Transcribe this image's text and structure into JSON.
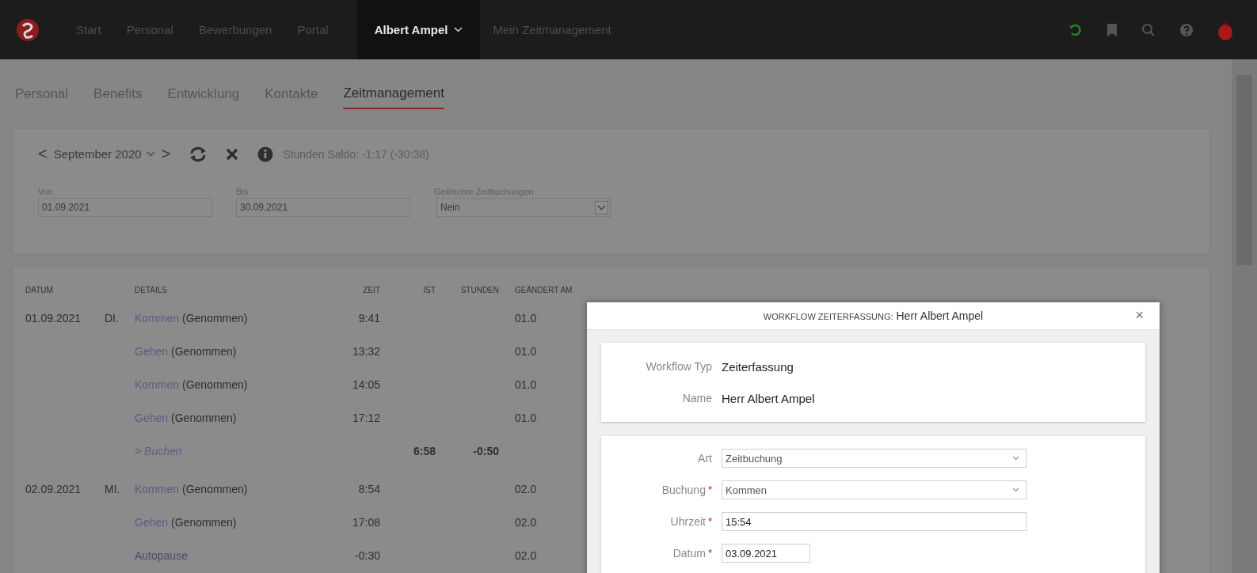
{
  "topbar": {
    "items": [
      {
        "label": "Start",
        "selected": false
      },
      {
        "label": "Personal",
        "selected": false
      },
      {
        "label": "Bewerbungen",
        "selected": false
      },
      {
        "label": "Portal",
        "selected": false
      },
      {
        "label": "Albert Ampel",
        "selected": true,
        "dropdown": true
      },
      {
        "label": "Mein Zeitmanagement",
        "selected": false
      }
    ]
  },
  "tabs": [
    {
      "label": "Personal",
      "selected": false
    },
    {
      "label": "Benefits",
      "selected": false
    },
    {
      "label": "Entwicklung",
      "selected": false
    },
    {
      "label": "Kontakte",
      "selected": false
    },
    {
      "label": "Zeitmanagement",
      "selected": true
    }
  ],
  "toolbar": {
    "prev": "<",
    "month": "September 2020",
    "next": ">",
    "saldo": "Stunden Saldo: -1:17 (-30:38)"
  },
  "filters": [
    {
      "label": "Von",
      "value": "01.09.2021",
      "kind": "input"
    },
    {
      "label": "Bis",
      "value": "30.09.2021",
      "kind": "input"
    },
    {
      "label": "Gelöschte Zeitbuchungen",
      "value": "Nein",
      "kind": "select"
    }
  ],
  "table": {
    "columns": [
      "DATUM",
      "DETAILS",
      "ZEIT",
      "IST",
      "STUNDEN",
      "GEÄNDERT AM"
    ],
    "rows": [
      {
        "kind": "booking",
        "date": "01.09.2021",
        "weekday": "DI.",
        "link": "Kommen",
        "status": "(Genommen)",
        "zeit": "9:41",
        "changed": "01.0"
      },
      {
        "kind": "booking",
        "link": "Gehen",
        "status": "(Genommen)",
        "zeit": "13:32",
        "changed": "01.0"
      },
      {
        "kind": "booking",
        "link": "Kommen",
        "status": "(Genommen)",
        "zeit": "14:05",
        "changed": "01.0"
      },
      {
        "kind": "booking",
        "link": "Gehen",
        "status": "(Genommen)",
        "zeit": "17:12",
        "changed": "01.0"
      },
      {
        "kind": "summary",
        "link": "> Buchen",
        "ist": "6:58",
        "stunden": "-0:50"
      },
      {
        "kind": "booking",
        "date": "02.09.2021",
        "weekday": "MI.",
        "link": "Kommen",
        "status": "(Genommen)",
        "zeit": "8:54",
        "changed": "02.0"
      },
      {
        "kind": "booking",
        "link": "Gehen",
        "status": "(Genommen)",
        "zeit": "17:08",
        "changed": "02.0"
      },
      {
        "kind": "pause",
        "link": "Autopause",
        "zeit": "-0:30",
        "changed": "02.0"
      }
    ]
  },
  "dialog": {
    "title_prefix": "WORKFLOW ZEITERFASSUNG:",
    "title_name": "Herr Albert Ampel",
    "close": "×",
    "info": [
      {
        "label": "Workflow Typ",
        "value": "Zeiterfassung"
      },
      {
        "label": "Name",
        "value": "Herr Albert Ampel"
      }
    ],
    "fields": [
      {
        "label": "Art",
        "value": "Zeitbuchung",
        "kind": "select"
      },
      {
        "label": "Buchung",
        "mark": "*",
        "value": "Kommen",
        "kind": "select"
      },
      {
        "label": "Uhrzeit",
        "mark": "*",
        "value": "15:54",
        "kind": "input"
      },
      {
        "label": "Datum",
        "mark": "*",
        "value": "03.09.2021",
        "kind": "date"
      }
    ]
  }
}
